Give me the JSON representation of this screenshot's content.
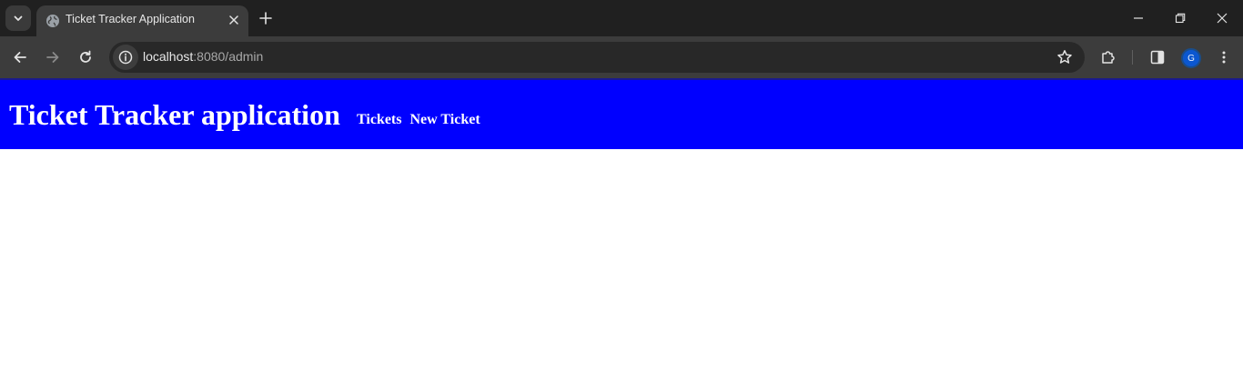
{
  "browser": {
    "tab_title": "Ticket Tracker Application",
    "url_host": "localhost",
    "url_rest": ":8080/admin",
    "profile_initial": "G",
    "icons": {
      "tab_search": "chevron-down-icon",
      "favicon": "globe-icon",
      "tab_close": "close-icon",
      "new_tab": "plus-icon",
      "minimize": "minimize-icon",
      "restore": "restore-icon",
      "close_window": "close-icon",
      "back": "arrow-left-icon",
      "forward": "arrow-right-icon",
      "reload": "reload-icon",
      "site_info": "info-icon",
      "bookmark": "star-icon",
      "extensions": "puzzle-icon",
      "side_panel": "side-panel-icon",
      "menu": "kebab-menu-icon"
    },
    "colors": {
      "tabstrip": "#202020",
      "toolbar": "#3c3c3c",
      "omnibox": "#282828"
    }
  },
  "app": {
    "title": "Ticket Tracker application",
    "nav": {
      "tickets": "Tickets",
      "new_ticket": "New Ticket"
    },
    "colors": {
      "header_bg": "#0000ff",
      "header_text": "#ffffff"
    }
  }
}
